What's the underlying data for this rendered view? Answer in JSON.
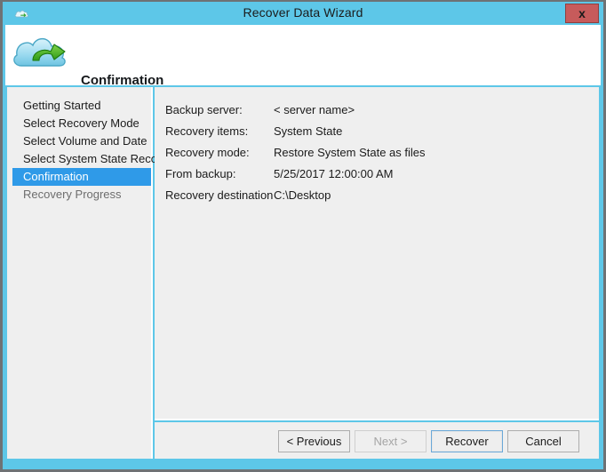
{
  "window": {
    "title": "Recover Data Wizard",
    "titlebar_icon": "cloud-icon",
    "close_label": "x",
    "accent_color": "#5dc7e8",
    "close_color": "#c75b5b"
  },
  "header": {
    "icon": "cloud-recovery-icon",
    "title": "Confirmation"
  },
  "sidebar": {
    "items": [
      {
        "label": "Getting Started",
        "state": "done"
      },
      {
        "label": "Select Recovery Mode",
        "state": "done"
      },
      {
        "label": "Select Volume and Date",
        "state": "done"
      },
      {
        "label": "Select System State Reco...",
        "state": "done"
      },
      {
        "label": "Confirmation",
        "state": "selected"
      },
      {
        "label": "Recovery Progress",
        "state": "pending"
      }
    ],
    "selected_color": "#2f9ae8"
  },
  "main": {
    "rows": [
      {
        "label": "Backup server:",
        "value": "< server name>"
      },
      {
        "label": "Recovery items:",
        "value": "System State"
      },
      {
        "label": "Recovery mode:",
        "value": "Restore System State as files"
      },
      {
        "label": "From backup:",
        "value": "5/25/2017 12:00:00 AM"
      },
      {
        "label": "Recovery destination",
        "value": "C:\\Desktop"
      }
    ]
  },
  "footer": {
    "buttons": [
      {
        "id": "previous",
        "label": "< Previous",
        "state": "normal"
      },
      {
        "id": "next",
        "label": "Next >",
        "state": "disabled"
      },
      {
        "id": "recover",
        "label": "Recover",
        "state": "default"
      },
      {
        "id": "cancel",
        "label": "Cancel",
        "state": "normal"
      }
    ]
  }
}
